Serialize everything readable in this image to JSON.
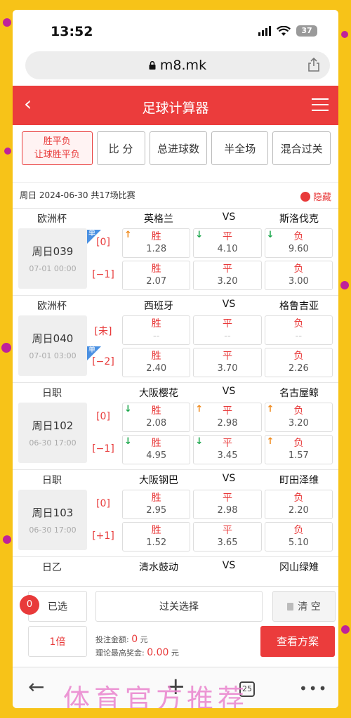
{
  "status": {
    "time": "13:52",
    "battery": "37"
  },
  "browser": {
    "url": "m8.mk",
    "tabs_count": "25"
  },
  "header": {
    "title": "足球计算器"
  },
  "tabs": {
    "active_line1": "胜平负",
    "active_line2": "让球胜平负",
    "t2": "比 分",
    "t3": "总进球数",
    "t4": "半全场",
    "t5": "混合过关"
  },
  "date_info": "周日 2024-06-30 共17场比赛",
  "hide_label": "隐藏",
  "vs": "VS",
  "outcome": {
    "win": "胜",
    "draw": "平",
    "lose": "负"
  },
  "dan": "单",
  "empty_odds": "--",
  "matches": [
    {
      "league": "欧洲杯",
      "home": "英格兰",
      "away": "斯洛伐克",
      "id": "周日039",
      "datetime": "07-01 00:00",
      "rows": [
        {
          "hc": "[0]",
          "odds": [
            "1.28",
            "4.10",
            "9.60"
          ]
        },
        {
          "hc": "[−1]",
          "odds": [
            "2.07",
            "3.20",
            "3.00"
          ]
        }
      ]
    },
    {
      "league": "欧洲杯",
      "home": "西班牙",
      "away": "格鲁吉亚",
      "id": "周日040",
      "datetime": "07-01 03:00",
      "rows": [
        {
          "hc": "[未]",
          "odds": [
            "--",
            "--",
            "--"
          ]
        },
        {
          "hc": "[−2]",
          "odds": [
            "2.40",
            "3.70",
            "2.26"
          ]
        }
      ]
    },
    {
      "league": "日职",
      "home": "大阪樱花",
      "away": "名古屋鲸",
      "id": "周日102",
      "datetime": "06-30 17:00",
      "rows": [
        {
          "hc": "[0]",
          "odds": [
            "2.08",
            "2.98",
            "3.20"
          ]
        },
        {
          "hc": "[−1]",
          "odds": [
            "4.95",
            "3.45",
            "1.57"
          ]
        }
      ]
    },
    {
      "league": "日职",
      "home": "大阪钢巴",
      "away": "町田泽维",
      "id": "周日103",
      "datetime": "06-30 17:00",
      "rows": [
        {
          "hc": "[0]",
          "odds": [
            "2.95",
            "2.98",
            "2.20"
          ]
        },
        {
          "hc": "[+1]",
          "odds": [
            "1.52",
            "3.65",
            "5.10"
          ]
        }
      ]
    },
    {
      "league": "日乙",
      "home": "清水鼓动",
      "away": "冈山绿雉"
    }
  ],
  "bet": {
    "count": "0",
    "selected": "已选",
    "pass": "过关选择",
    "clear": "清 空",
    "multiple": "1倍",
    "stake_label": "投注金额:",
    "stake_value": "0",
    "stake_unit": "元",
    "max_label": "理论最高奖金:",
    "max_value": "0.00",
    "max_unit": "元",
    "view": "查看方案"
  },
  "watermark": "体育官方推荐",
  "colors": {
    "brand": "#eb3c3c",
    "up": "#f08a1c",
    "down": "#1aa64a",
    "dan": "#4a90e2"
  },
  "icons": [
    "signal-icon",
    "wifi-icon",
    "battery-icon",
    "lock-icon",
    "share-icon",
    "back-icon",
    "menu-icon",
    "up-arrow-icon",
    "down-arrow-icon",
    "trash-icon",
    "plus-icon",
    "more-icon"
  ]
}
